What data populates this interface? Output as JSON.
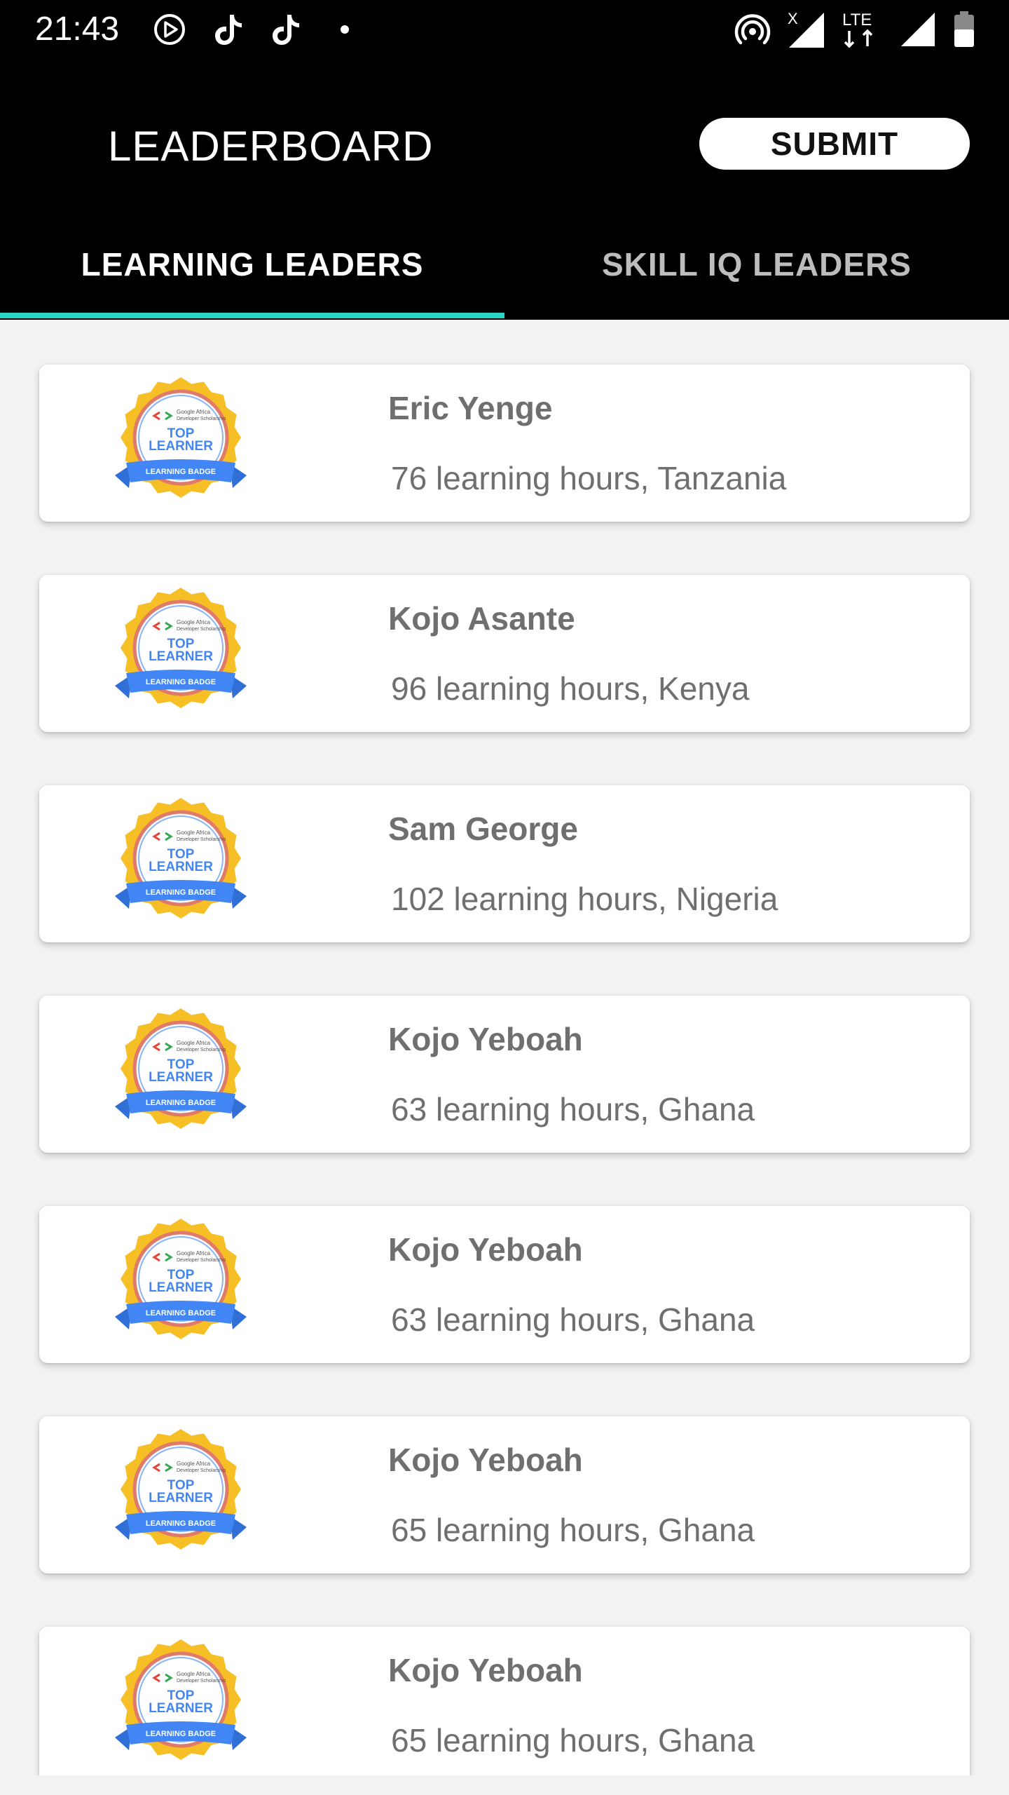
{
  "status_bar": {
    "time": "21:43",
    "icons": [
      "play-store-icon",
      "tiktok-icon",
      "tiktok-icon",
      "notification-dot-icon",
      "hotspot-icon",
      "signal-x-icon",
      "lte-icon",
      "signal-icon",
      "battery-icon"
    ],
    "lte_label": "LTE",
    "x_label": "X"
  },
  "app_bar": {
    "title": "LEADERBOARD",
    "submit_label": "SUBMIT"
  },
  "tabs": [
    {
      "label": "LEARNING LEADERS",
      "selected": true
    },
    {
      "label": "SKILL IQ LEADERS",
      "selected": false
    }
  ],
  "colors": {
    "accent": "#2bd6c6",
    "app_bar": "#000000",
    "background": "#f2f2f2",
    "card_text": "#6f6f6f",
    "badge_gold": "#f6bf26",
    "badge_blue": "#4285f4"
  },
  "badge": {
    "line1": "Google Africa",
    "line2": "Developer Scholarship",
    "top": "TOP",
    "learner": "LEARNER",
    "ribbon": "LEARNING BADGE"
  },
  "leaders": [
    {
      "name": "Eric Yenge",
      "detail": "76 learning hours, Tanzania"
    },
    {
      "name": "Kojo Asante",
      "detail": "96 learning hours, Kenya"
    },
    {
      "name": "Sam George",
      "detail": "102 learning hours, Nigeria"
    },
    {
      "name": "Kojo Yeboah",
      "detail": "63 learning hours, Ghana"
    },
    {
      "name": "Kojo Yeboah",
      "detail": "63 learning hours, Ghana"
    },
    {
      "name": "Kojo Yeboah",
      "detail": "65 learning hours, Ghana"
    },
    {
      "name": "Kojo Yeboah",
      "detail": "65 learning hours, Ghana"
    }
  ]
}
